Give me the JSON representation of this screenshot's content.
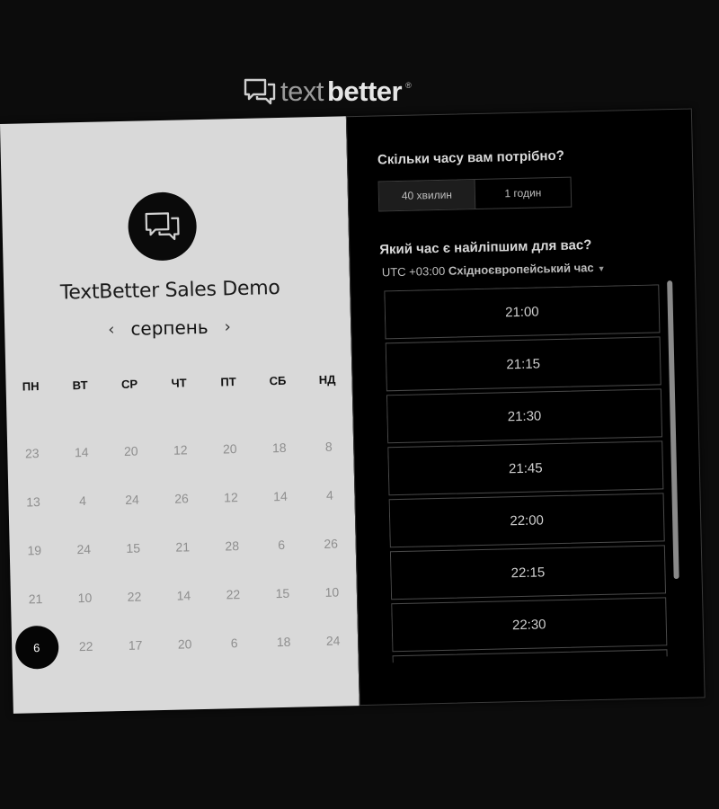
{
  "brand": {
    "logo_part1": "text",
    "logo_part2": "better",
    "reg": "®"
  },
  "event": {
    "title": "TextBetter Sales Demo"
  },
  "calendar": {
    "month": "серпень",
    "prev_icon": "chevron-left-icon",
    "next_icon": "chevron-right-icon",
    "weekdays": [
      "ПН",
      "ВТ",
      "СР",
      "ЧТ",
      "ПТ",
      "СБ",
      "НД"
    ],
    "weeks": [
      [
        "23",
        "14",
        "20",
        "12",
        "20",
        "18",
        "8"
      ],
      [
        "13",
        "4",
        "24",
        "26",
        "12",
        "14",
        "4"
      ],
      [
        "19",
        "24",
        "15",
        "21",
        "28",
        "6",
        "26"
      ],
      [
        "21",
        "10",
        "22",
        "14",
        "22",
        "15",
        "10"
      ],
      [
        "6",
        "22",
        "17",
        "20",
        "6",
        "18",
        "24"
      ]
    ],
    "selected": "6"
  },
  "duration": {
    "question": "Скільки часу вам потрібно?",
    "options": [
      "40 хвилин",
      "1 годин"
    ],
    "selected": "40 хвилин"
  },
  "time": {
    "question": "Який час є найліпшим для вас?",
    "tz_offset": "UTC +03:00",
    "tz_name": "Східноєвропейський час",
    "slots": [
      "21:00",
      "21:15",
      "21:30",
      "21:45",
      "22:00",
      "22:15",
      "22:30",
      ""
    ]
  },
  "colors": {
    "background": "#0c0c0c",
    "calendar_bg": "#d9d9d9",
    "panel_bg": "#000000",
    "selected_day": "#050505"
  }
}
